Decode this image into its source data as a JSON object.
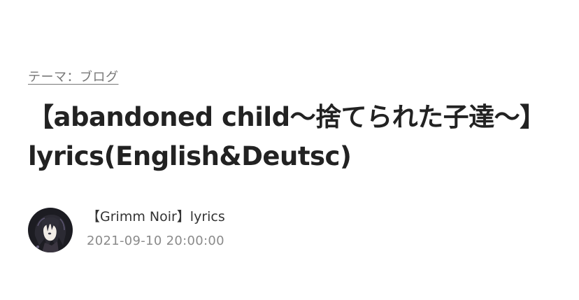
{
  "theme": {
    "label": "テーマ：ブログ"
  },
  "article": {
    "title": "【abandoned child〜捨てられた子達〜】lyrics(English&Deutsc)"
  },
  "author": {
    "name": "【Grimm Noir】lyrics",
    "avatar_icon": "avatar-dark-hair-character-icon"
  },
  "post": {
    "date": "2021-09-10 20:00:00"
  }
}
